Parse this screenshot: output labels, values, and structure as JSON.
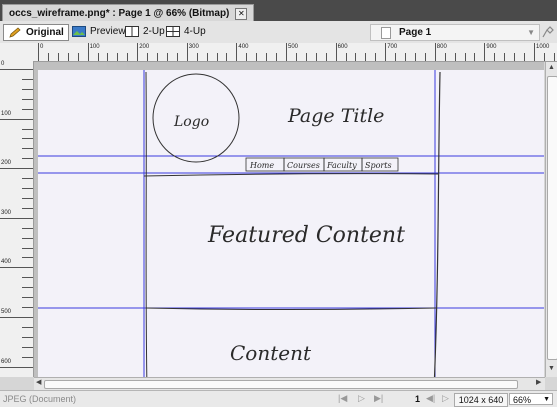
{
  "tab": {
    "title": "occs_wireframe.png* : Page 1 @ 66% (Bitmap)",
    "close": "✕"
  },
  "toolbar": {
    "original": "Original",
    "preview": "Preview",
    "two_up": "2-Up",
    "four_up": "4-Up",
    "page_label": "Page 1"
  },
  "ruler": {
    "top_labels": [
      "0",
      "100",
      "200",
      "300",
      "400",
      "500",
      "600",
      "700",
      "800",
      "900",
      "1000"
    ],
    "left_labels": [
      "0",
      "100",
      "200",
      "300",
      "400",
      "500",
      "600"
    ]
  },
  "wireframe": {
    "logo": "Logo",
    "page_title": "Page Title",
    "nav": [
      "Home",
      "Courses",
      "Faculty",
      "Sports"
    ],
    "featured": "Featured Content",
    "content": "Content"
  },
  "status": {
    "format": "JPEG (Document)",
    "page": "1",
    "dimensions": "1024 x 640",
    "zoom": "66%"
  },
  "colors": {
    "guide": "#3a3ae0",
    "paper": "#f3f2f9"
  }
}
